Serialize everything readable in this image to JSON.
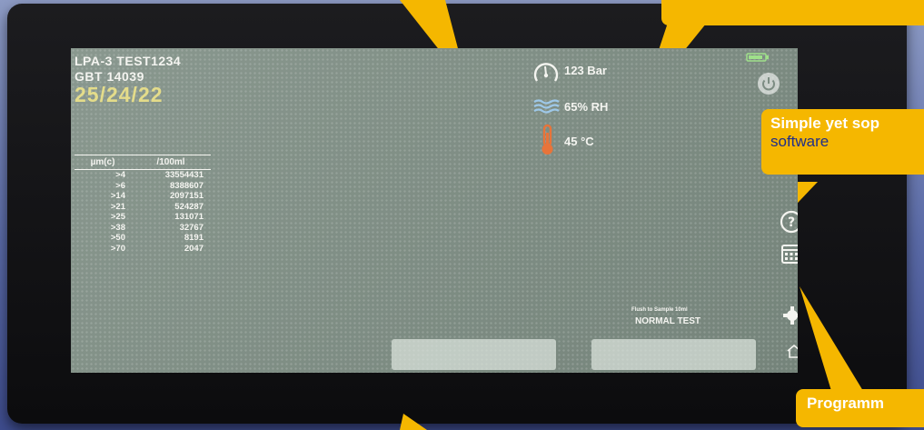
{
  "device": {
    "model_line": "LPA-3  TEST1234",
    "standard_line": "GBT 14039",
    "date_code": "25/24/22"
  },
  "particle_table": {
    "headers": [
      "µm(c)",
      "/100ml"
    ],
    "rows": [
      {
        "size": ">4",
        "count": "33554431"
      },
      {
        "size": ">6",
        "count": "8388607"
      },
      {
        "size": ">14",
        "count": "2097151"
      },
      {
        "size": ">21",
        "count": "524287"
      },
      {
        "size": ">25",
        "count": "131071"
      },
      {
        "size": ">38",
        "count": "32767"
      },
      {
        "size": ">50",
        "count": "8191"
      },
      {
        "size": ">70",
        "count": "2047"
      }
    ]
  },
  "readouts": {
    "pressure": "123 Bar",
    "humidity": "65% RH",
    "temperature": "45 °C"
  },
  "test": {
    "mode_subtitle": "Flush to Sample 10ml",
    "mode": "NORMAL TEST"
  },
  "callouts": {
    "software_line1": "Simple yet sop",
    "software_line2": "software",
    "programmable": "Programm"
  },
  "icons": [
    "gauge-icon",
    "humidity-icon",
    "thermometer-icon",
    "battery-icon",
    "power-icon",
    "help-icon",
    "calendar-icon",
    "settings-icon",
    "home-icon"
  ],
  "colors": {
    "screen": "#7c8c82",
    "date": "#e4dc8a",
    "thermometer": "#e8743a",
    "humidity": "#9ec8e8",
    "callout": "#f5b700",
    "callout_text_blue": "#1f2f8a"
  }
}
